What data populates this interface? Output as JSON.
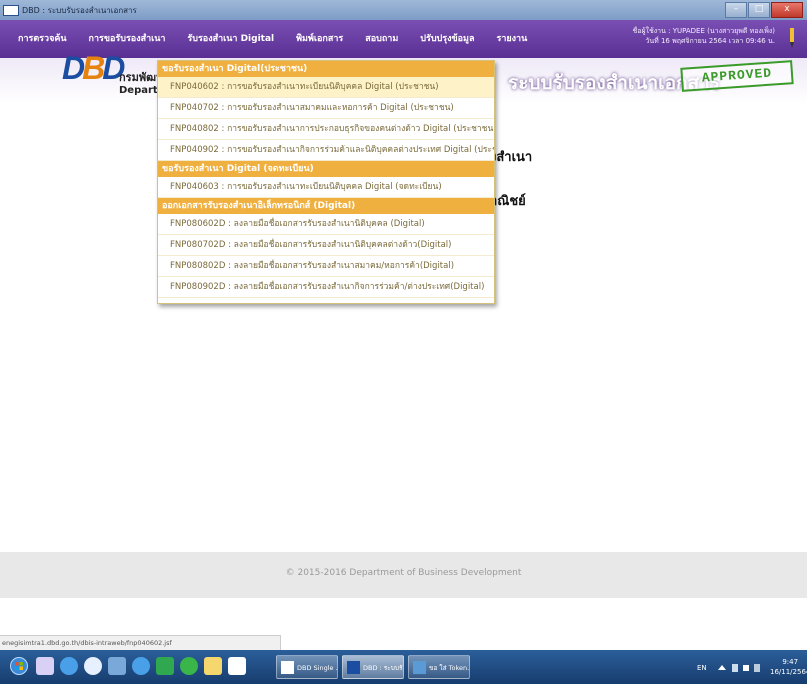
{
  "window": {
    "title": "DBD : ระบบรับรองสำเนาเอกสาร",
    "btn_min": "–",
    "btn_max": "□",
    "btn_close": "x"
  },
  "nav": {
    "items": [
      "การตรวจค้น",
      "การขอรับรองสำเนา",
      "รับรองสำเนา Digital",
      "พิมพ์เอกสาร",
      "สอบถาม",
      "ปรับปรุงข้อมูล",
      "รายงาน"
    ]
  },
  "user": {
    "line1": "ชื่อผู้ใช้งาน : YUPADEE (นางสาวยุพดี ทองเพ็ง)",
    "line2": "วันที่ 16 พฤศจิกายน 2564 เวลา 09:46 น."
  },
  "banner": {
    "logo_a": "D",
    "logo_b": "B",
    "logo_c": "D",
    "dept_line1": "กรมพัฒน",
    "dept_line2": "Departm",
    "title": "ระบบรับรองสำเนาเอกสาร",
    "stamp": "APPROVED"
  },
  "main": {
    "heading1": "งสำเนา",
    "heading2": "าณิชย์"
  },
  "dropdown": {
    "section1": "ขอรับรองสำเนา Digital(ประชาชน)",
    "items1": [
      "FNP040602 : การขอรับรองสำเนาทะเบียนนิติบุคคล Digital (ประชาชน)",
      "FNP040702 : การขอรับรองสำเนาสมาคมและหอการค้า Digital (ประชาชน)",
      "FNP040802 : การขอรับรองสำเนาการประกอบธุรกิจของคนต่างด้าว Digital (ประชาชน)",
      "FNP040902 : การขอรับรองสำเนากิจการร่วมค้าและนิติบุคคลต่างประเทศ Digital (ประชาชน)"
    ],
    "section2": "ขอรับรองสำเนา Digital (จดทะเบียน)",
    "items2": [
      "FNP040603 : การขอรับรองสำเนาทะเบียนนิติบุคคล Digital (จดทะเบียน)"
    ],
    "section3": "ออกเอกสารรับรองสำเนาอิเล็กทรอนิกส์ (Digital)",
    "items3": [
      "FNP080602D : ลงลายมือชื่อเอกสารรับรองสำเนานิติบุคคล (Digital)",
      "FNP080702D : ลงลายมือชื่อเอกสารรับรองสำเนานิติบุคคลต่างด้าว(Digital)",
      "FNP080802D : ลงลายมือชื่อเอกสารรับรองสำเนาสมาคม/หอการค้า(Digital)",
      "FNP080902D : ลงลายมือชื่อเอกสารรับรองสำเนากิจการร่วมค้า/ต่างประเทศ(Digital)"
    ]
  },
  "footer": "© 2015-2016 Department of Business Development",
  "statusbar": "enegisimtra1.dbd.go.th/dbis-intraweb/fnp040602.jsf",
  "taskbar": {
    "btn1": "DBD Single ...",
    "btn2": "DBD : ระบบรั...",
    "btn3": "ขอ ใส่ Token...",
    "tray": "EN",
    "time": "9:47",
    "date": "16/11/2564"
  }
}
